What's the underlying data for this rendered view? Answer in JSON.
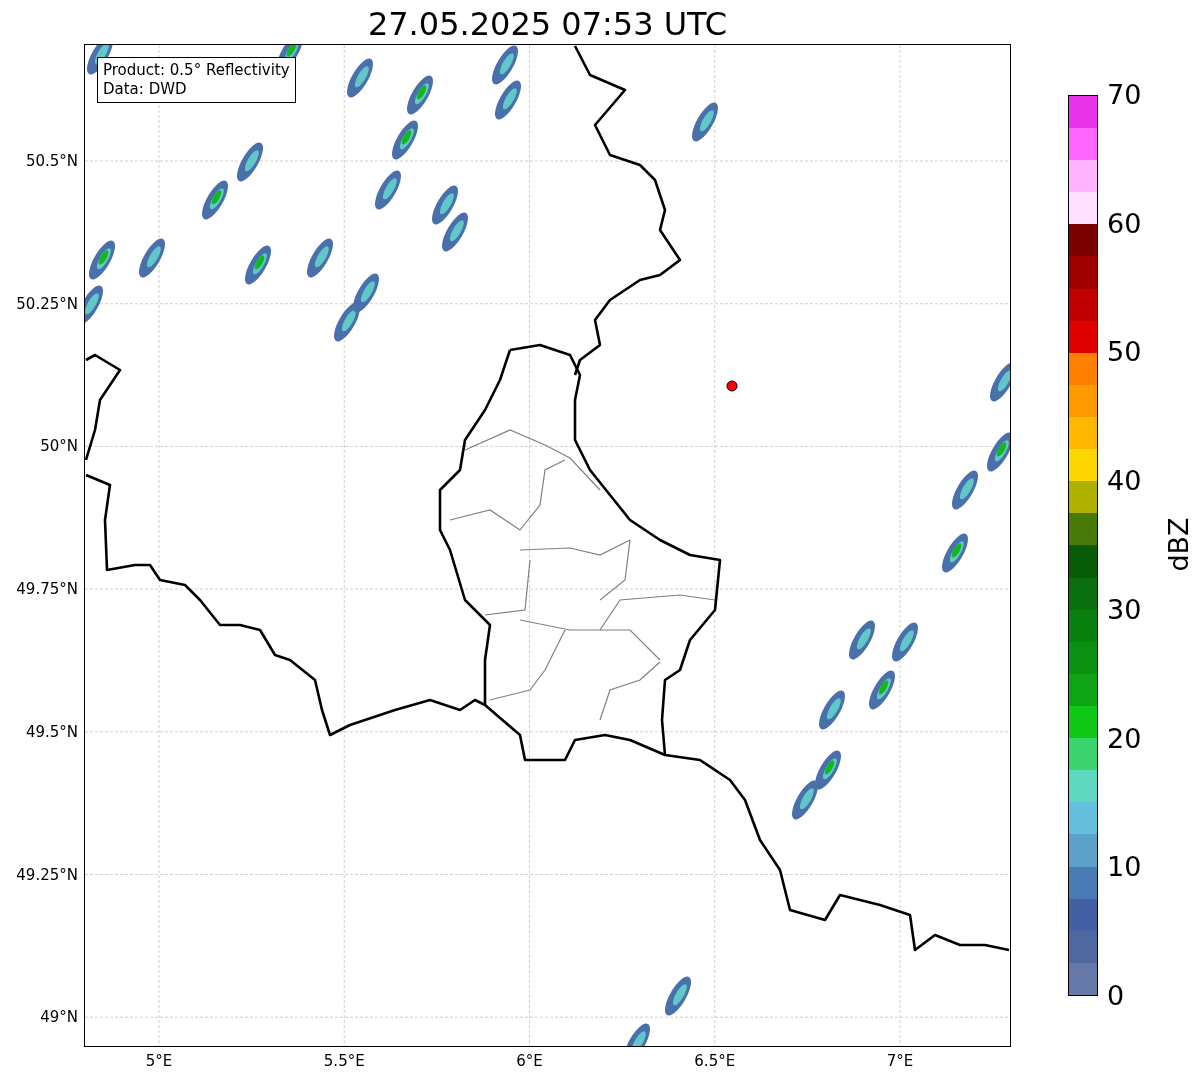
{
  "title": "27.05.2025 07:53 UTC",
  "legend": {
    "lines": [
      "Product: 0.5° Reflectivity",
      "Data: DWD"
    ]
  },
  "map": {
    "lat_ticks": [
      "50.5°N",
      "50.25°N",
      "50°N",
      "49.75°N",
      "49.5°N",
      "49.25°N",
      "49°N"
    ],
    "lon_ticks": [
      "5°E",
      "5.5°E",
      "6°E",
      "6.5°E",
      "7°E"
    ]
  },
  "colorbar": {
    "label": "dBZ",
    "ticks": [
      "70",
      "60",
      "50",
      "40",
      "30",
      "20",
      "10",
      "0"
    ],
    "bins": [
      {
        "color": "#6678a8"
      },
      {
        "color": "#5068a0"
      },
      {
        "color": "#4460a4"
      },
      {
        "color": "#4a7ab4"
      },
      {
        "color": "#5aa0c8"
      },
      {
        "color": "#64c0dc"
      },
      {
        "color": "#60d8c0"
      },
      {
        "color": "#3cd46c"
      },
      {
        "color": "#10c818"
      },
      {
        "color": "#0ea414"
      },
      {
        "color": "#0c9012"
      },
      {
        "color": "#0a800f"
      },
      {
        "color": "#0a700f"
      },
      {
        "color": "#085c08"
      },
      {
        "color": "#487a0a"
      },
      {
        "color": "#b0b000"
      },
      {
        "color": "#ffd700"
      },
      {
        "color": "#ffb700"
      },
      {
        "color": "#ff9b00"
      },
      {
        "color": "#ff7f00"
      },
      {
        "color": "#e00000"
      },
      {
        "color": "#c00000"
      },
      {
        "color": "#a00000"
      },
      {
        "color": "#7a0000"
      },
      {
        "color": "#ffe0ff"
      },
      {
        "color": "#ffb3ff"
      },
      {
        "color": "#ff66ff"
      },
      {
        "color": "#e933e9"
      }
    ]
  }
}
